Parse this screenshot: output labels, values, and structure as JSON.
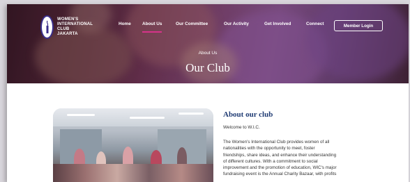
{
  "brand": {
    "line1": "WOMEN'S",
    "line2": "INTERNATIONAL",
    "line3": "CLUB",
    "line4": "JAKARTA"
  },
  "nav": {
    "items": [
      {
        "label": "Home",
        "active": false
      },
      {
        "label": "About Us",
        "active": true
      },
      {
        "label": "Our Committee",
        "active": false
      },
      {
        "label": "Our Activity",
        "active": false
      },
      {
        "label": "Get Involved",
        "active": false
      },
      {
        "label": "Connect",
        "active": false
      }
    ],
    "member_login": "Member Login",
    "active_color": "#d6338a"
  },
  "hero": {
    "breadcrumb": "About Us",
    "title": "Our Club"
  },
  "about": {
    "heading": "About our club",
    "welcome": "Welcome to W.I.C.",
    "body_lines": [
      "The Women's International Club provides women of all",
      "nationalities with the opportunity to meet, foster",
      "friendships, share ideas, and enhance their understanding",
      "of different cultures. With a commitment to social",
      "improvement and the promotion of education, WIC's major",
      "fundraising event is the Annual Charity Bazaar, with profits"
    ],
    "heading_color": "#1f3b73"
  }
}
